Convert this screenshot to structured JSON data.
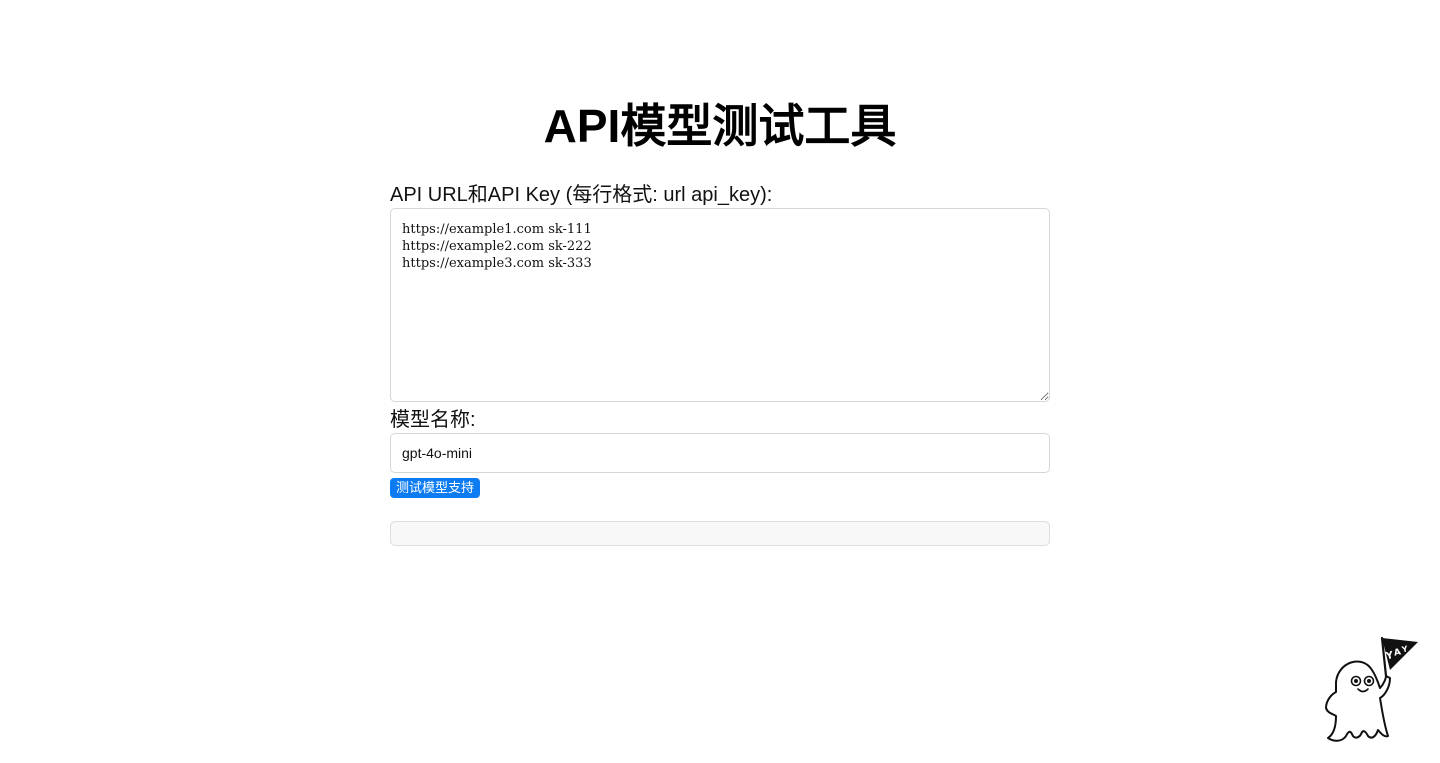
{
  "page": {
    "title": "API模型测试工具"
  },
  "form": {
    "urls_label": "API URL和API Key (每行格式: url api_key):",
    "urls_value": "https://example1.com sk-111\nhttps://example2.com sk-222\nhttps://example3.com sk-333",
    "model_label": "模型名称:",
    "model_value": "gpt-4o-mini",
    "submit_label": "测试模型支持"
  },
  "result": {
    "text": ""
  },
  "mascot": {
    "flag_text": "YAY",
    "icon": "ghost-mascot-icon"
  },
  "colors": {
    "accent": "#0d7cf2",
    "border": "#d6d6d6",
    "result_bg": "#f8f8f8"
  }
}
